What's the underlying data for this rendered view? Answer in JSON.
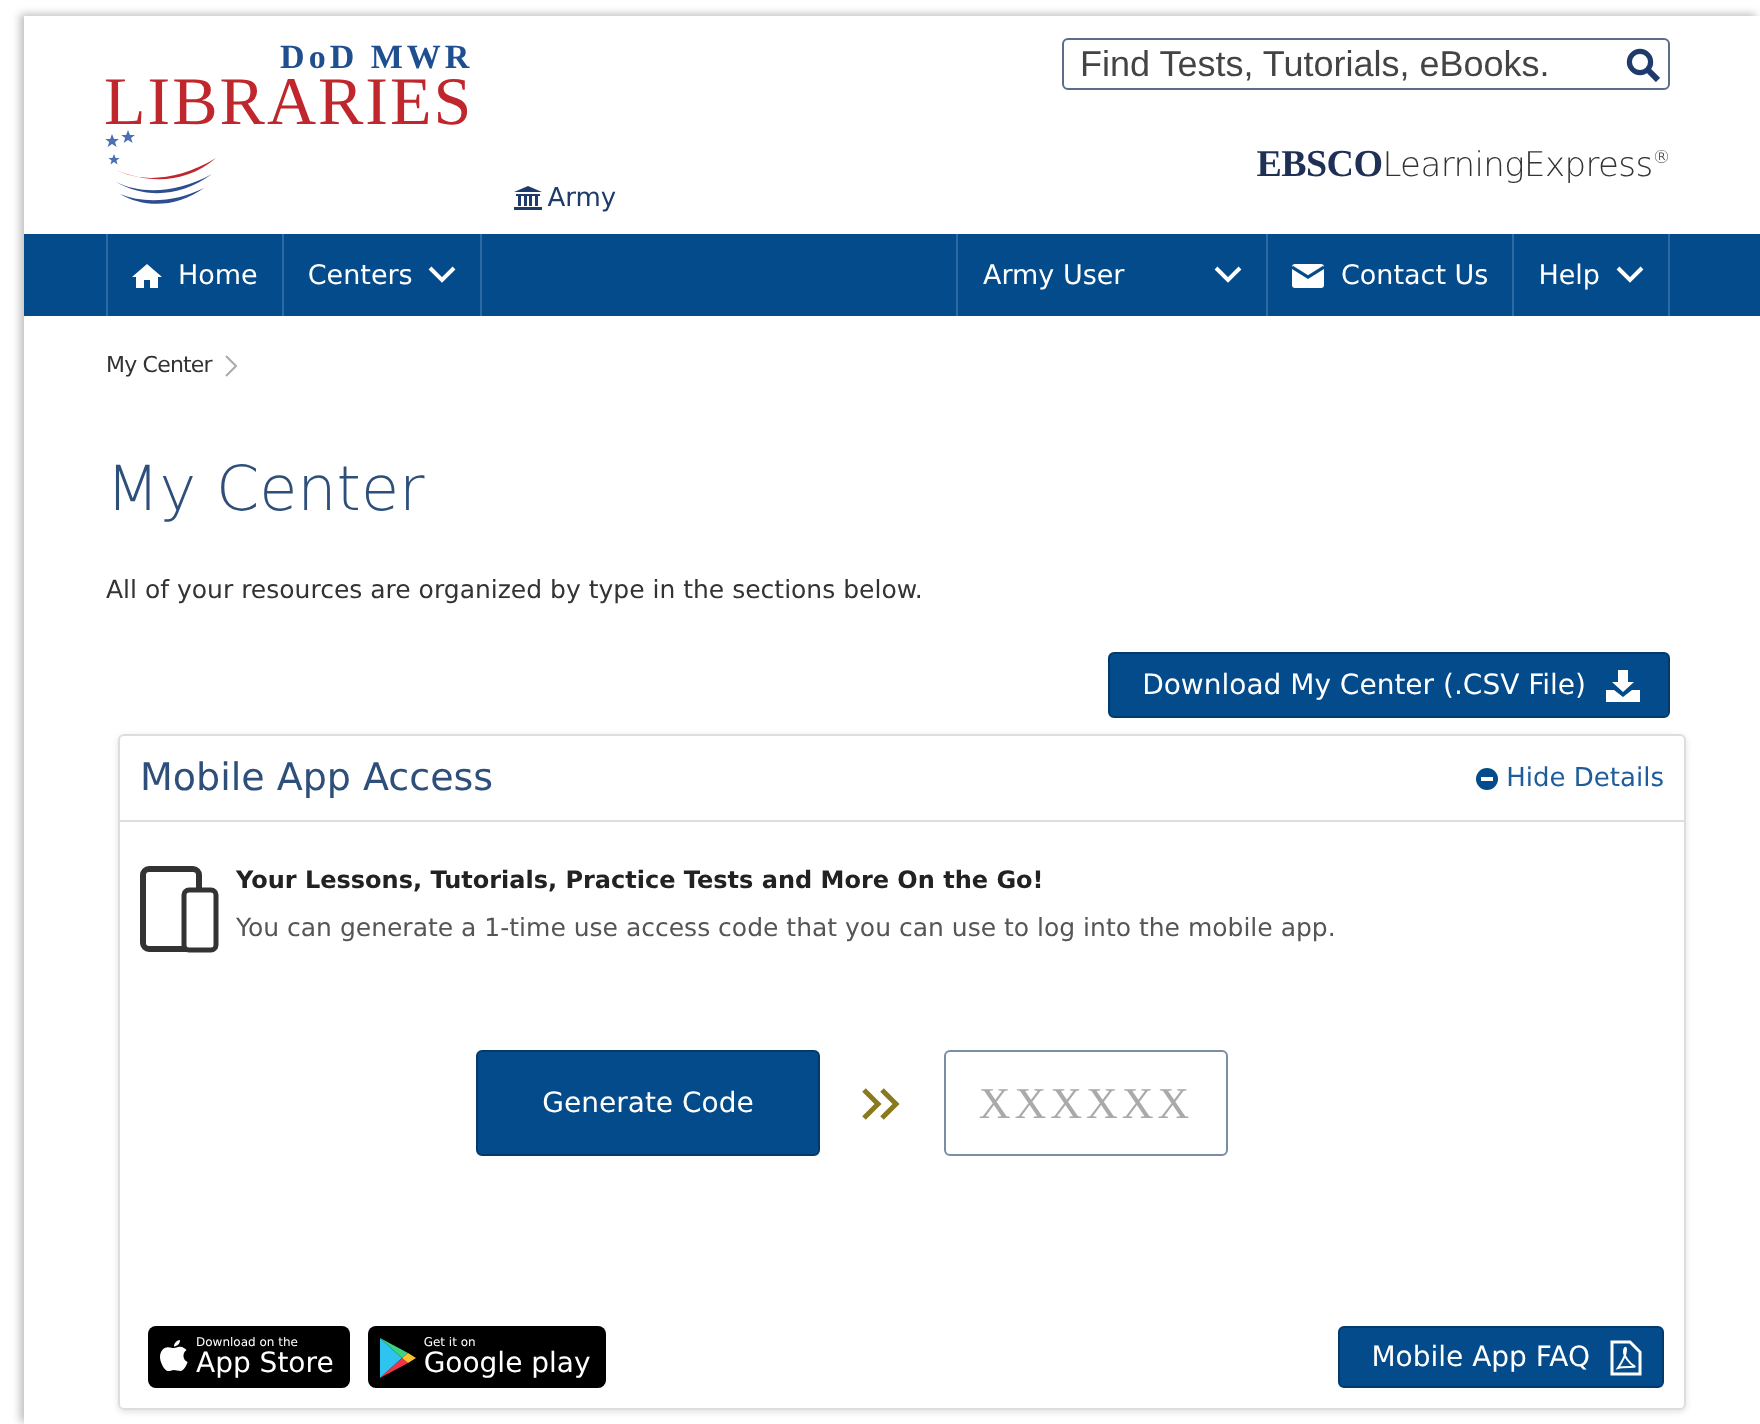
{
  "header": {
    "logo_top": "DoD MWR",
    "logo_main": "LIBRARIES",
    "branch": "Army",
    "search": {
      "placeholder": "Find Tests, Tutorials, eBooks."
    },
    "brand": "**EBSCO**LearningExpress$^{®}$"
  },
  "nav": {
    "left_items": [
      {
        "label": "Home",
        "kind": "home"
      },
      {
        "label": "Centers",
        "kind": "dropdown"
      }
    ],
    "right_items": [
      {
        "label": "Army User",
        "kind": "dropdown"
      },
      {
        "label": "Contact Us",
        "kind": "mail"
      },
      {
        "label": "Help",
        "kind": "dropdown"
      }
    ]
  },
  "breadcrumb": [
    "My Center"
  ],
  "page": {
    "title": "My Center",
    "intro": "All of your resources are organized by type in the sections below.",
    "download_button": "Download My Center (.CSV File)"
  },
  "panel": {
    "title": "Mobile App Access",
    "toggle": "Hide Details",
    "heading": "Your Lessons, Tutorials, Practice Tests and More On the Go!",
    "description": "You can generate a 1-time use access code that you can use to log into the mobile app.",
    "generate_button": "Generate Code",
    "code_field": {
      "placeholder": "XXXXXX"
    },
    "badges": [
      {
        "kind": "apple",
        "small": "Download on the",
        "big": "App Store"
      },
      {
        "kind": "google",
        "small": "Get it on",
        "big": "Google play"
      }
    ],
    "faq_button": "Mobile App FAQ"
  }
}
